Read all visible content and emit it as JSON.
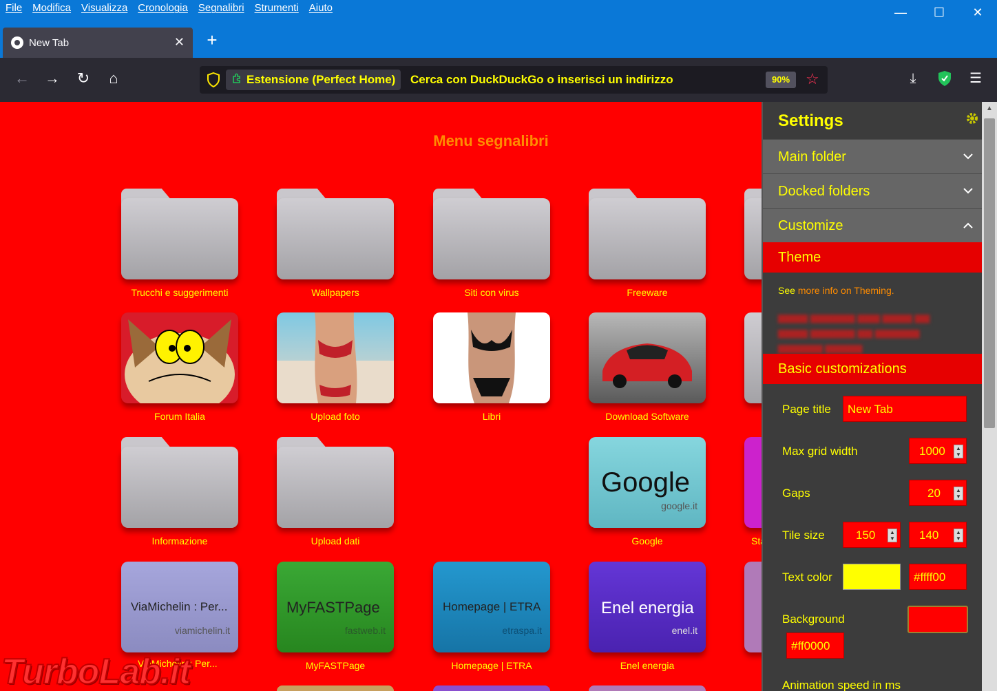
{
  "menubar": {
    "items": [
      "File",
      "Modifica",
      "Visualizza",
      "Cronologia",
      "Segnalibri",
      "Strumenti",
      "Aiuto"
    ],
    "minimize": "—",
    "maximize": "☐",
    "close": "✕"
  },
  "tab": {
    "title": "New Tab",
    "close": "✕",
    "new_tab": "+"
  },
  "nav": {
    "back": "←",
    "forward": "→",
    "reload": "↻",
    "home": "⌂",
    "extension_label": "Estensione (Perfect Home)",
    "url_placeholder": "Cerca con DuckDuckGo o inserisci un indirizzo",
    "zoom": "90%",
    "bookmark_star": "☆",
    "download": "⤓",
    "menu": "☰"
  },
  "content": {
    "heading": "Menu segnalibri",
    "folders": [
      {
        "label": "Trucchi e suggerimenti"
      },
      {
        "label": "Wallpapers"
      },
      {
        "label": "Siti con virus"
      },
      {
        "label": "Freeware"
      },
      {
        "label": "Informazione"
      },
      {
        "label": "Upload dati"
      }
    ],
    "image_tiles": [
      {
        "label": "Forum Italia"
      },
      {
        "label": "Upload foto"
      },
      {
        "label": "Libri"
      },
      {
        "label": "Download Software"
      }
    ],
    "site_tiles": [
      {
        "name": "Google",
        "domain": "google.it",
        "label": "Google",
        "color": "#7dcfd8"
      },
      {
        "name": "ViaMichelin : Per...",
        "domain": "viamichelin.it",
        "label": "ViaMichelin : Per...",
        "color": "#9a9acc"
      },
      {
        "name": "MyFASTPage",
        "domain": "fastweb.it",
        "label": "MyFASTPage",
        "color": "#2e9b2a"
      },
      {
        "name": "Homepage | ETRA",
        "domain": "etraspa.it",
        "label": "Homepage | ETRA",
        "color": "#1e8cc0"
      },
      {
        "name": "Enel energia",
        "domain": "enel.it",
        "label": "Enel energia",
        "color": "#5a2fc8"
      }
    ],
    "partial_labels": [
      "Sta"
    ]
  },
  "settings": {
    "title": "Settings",
    "main_folder": "Main folder",
    "docked_folders": "Docked folders",
    "customize": "Customize",
    "theme": "Theme",
    "see": "See ",
    "more_info": "more info on Theming.",
    "basic": "Basic customizations",
    "page_title_label": "Page title",
    "page_title_value": "New Tab",
    "max_grid_label": "Max grid width",
    "max_grid_value": "1000",
    "gaps_label": "Gaps",
    "gaps_value": "20",
    "tile_size_label": "Tile size",
    "tile_w": "150",
    "tile_h": "140",
    "text_color_label": "Text color",
    "text_color_value": "#ffff00",
    "background_label": "Background",
    "background_value": "#ff0000",
    "animation_label": "Animation speed in ms"
  },
  "colors": {
    "page_bg": "#ff0000",
    "text_yellow": "#ffff00",
    "heading_orange": "#ff8c00",
    "titlebar_blue": "#0a78d7"
  },
  "watermark": "TurboLab.it"
}
